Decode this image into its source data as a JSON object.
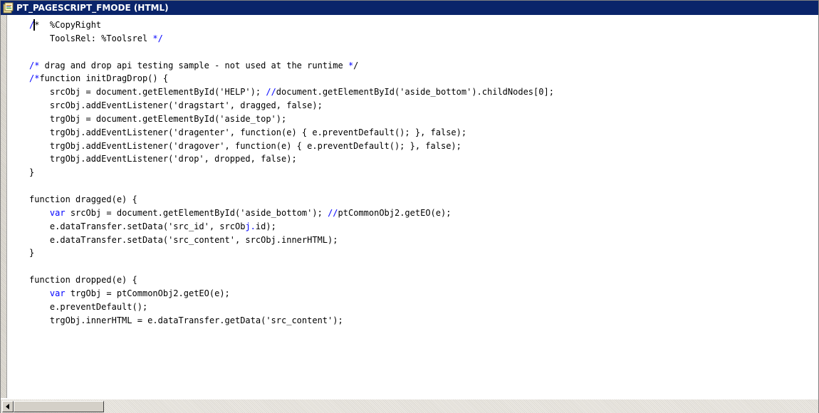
{
  "window": {
    "title": "PT_PAGESCRIPT_FMODE (HTML)",
    "icon": "html-document-icon"
  },
  "editor": {
    "lines": [
      "/*  %CopyRight",
      "    ToolsRel: %Toolsrel */",
      "",
      "/* drag and drop api testing sample - not used at the runtime */",
      "/*function initDragDrop() {",
      "    srcObj = document.getElementById('HELP'); //document.getElementById('aside_bottom').childNodes[0];",
      "    srcObj.addEventListener('dragstart', dragged, false);",
      "    trgObj = document.getElementById('aside_top');",
      "    trgObj.addEventListener('dragenter', function(e) { e.preventDefault(); }, false);",
      "    trgObj.addEventListener('dragover', function(e) { e.preventDefault(); }, false);",
      "    trgObj.addEventListener('drop', dropped, false);",
      "}",
      "",
      "function dragged(e) {",
      "    var srcObj = document.getElementById('aside_bottom'); //ptCommonObj2.getEO(e);",
      "    e.dataTransfer.setData('src_id', srcObj.id);",
      "    e.dataTransfer.setData('src_content', srcObj.innerHTML);",
      "}",
      "",
      "function dropped(e) {",
      "    var trgObj = ptCommonObj2.getEO(e);",
      "    e.preventDefault();",
      "    trgObj.innerHTML = e.dataTransfer.getData('src_content');"
    ],
    "highlight": [
      {
        "line": 0,
        "ranges": [
          [
            0,
            1
          ]
        ]
      },
      {
        "line": 1,
        "ranges": [
          [
            24,
            26
          ]
        ]
      },
      {
        "line": 3,
        "ranges": [
          [
            0,
            2
          ],
          [
            61,
            63
          ]
        ]
      },
      {
        "line": 4,
        "ranges": [
          [
            0,
            2
          ]
        ]
      },
      {
        "line": 5,
        "ranges": [
          [
            46,
            48
          ]
        ]
      },
      {
        "line": 14,
        "ranges": [
          [
            4,
            7
          ],
          [
            58,
            60
          ]
        ]
      },
      {
        "line": 15,
        "ranges": [
          [
            42,
            44
          ]
        ]
      },
      {
        "line": 20,
        "ranges": [
          [
            4,
            7
          ]
        ]
      }
    ]
  },
  "colors": {
    "titlebar": "#0a246a",
    "keyword": "#0000ff",
    "text": "#000000"
  },
  "scrollbar": {
    "left_arrow_icon": "left-arrow-icon"
  }
}
